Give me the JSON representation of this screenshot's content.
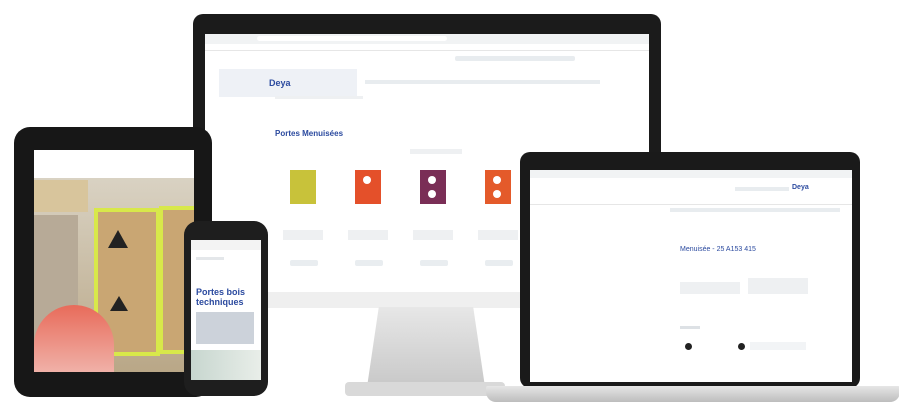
{
  "monitor": {
    "logo": "Deya",
    "page_title": "Portes Menuisées",
    "products": [
      {
        "name": "",
        "color": "#c8c23a",
        "holes": 0
      },
      {
        "name": "",
        "color": "#e4502a",
        "holes": 1
      },
      {
        "name": "",
        "color": "#7a2e56",
        "holes": 2
      },
      {
        "name": "",
        "color": "#e45a2a",
        "holes": 2
      },
      {
        "name": "",
        "color": "#ef7f2a",
        "holes": 2
      }
    ]
  },
  "laptop": {
    "logo": "Deya",
    "title": "Menuisée - 25 A153 415"
  },
  "phone": {
    "headline": "Portes bois techniques"
  }
}
